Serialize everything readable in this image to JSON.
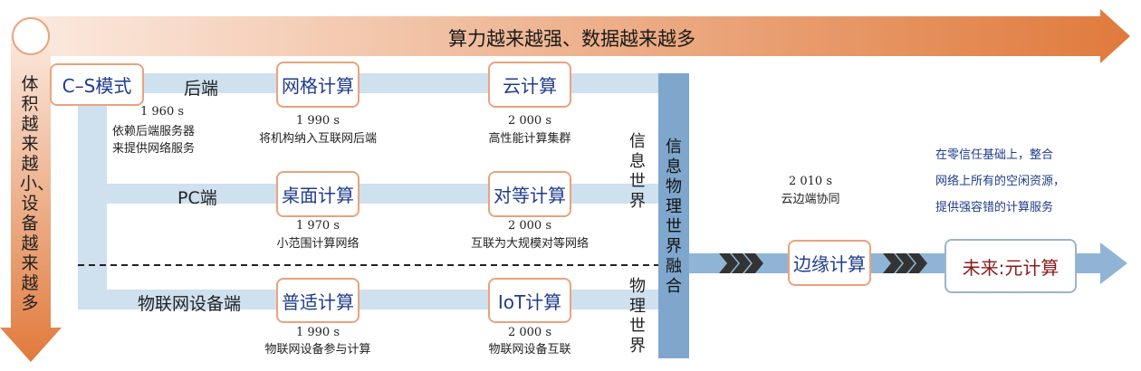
{
  "header": {
    "top_banner": "算力越来越强、数据越来越多"
  },
  "left_banner": "体积越来越小、设备越来越多",
  "rows": {
    "backend": "后端",
    "pc": "PC端",
    "iot": "物联网设备端"
  },
  "nodes": {
    "cs": {
      "label": "C–S模式",
      "year": "1 960 s",
      "desc": [
        "依赖后端服务器",
        "来提供网络服务"
      ]
    },
    "grid": {
      "label": "网格计算",
      "year": "1 990 s",
      "desc": "将机构纳入互联网后端"
    },
    "cloud": {
      "label": "云计算",
      "year": "2 000 s",
      "desc": "高性能计算集群"
    },
    "desktop": {
      "label": "桌面计算",
      "year": "1 970 s",
      "desc": "小范围计算网络"
    },
    "p2p": {
      "label": "对等计算",
      "year": "2 000 s",
      "desc": "互联为大规模对等网络"
    },
    "pervasive": {
      "label": "普适计算",
      "year": "1 990 s",
      "desc": "物联网设备参与计算"
    },
    "iot": {
      "label": "IoT计算",
      "year": "2 000 s",
      "desc": "物联网设备互联"
    },
    "edge": {
      "label": "边缘计算",
      "year": "2 010 s",
      "desc": "云边端协同"
    },
    "meta": {
      "label": "未来:元计算",
      "desc": [
        "在零信任基础上，整合",
        "网络上所有的空闲资源，",
        "提供强容错的计算服务"
      ]
    }
  },
  "labels": {
    "info_world": "信息世界",
    "physical_world": "物理世界",
    "cps_fusion": "信息物理世界融合"
  },
  "colors": {
    "accent_orange": "#e07a3c",
    "bar_blue": "#cfe0ef",
    "fusion_blue": "#7fa6cc",
    "meta_text": "#8b1a1a",
    "desc_blue": "#1f3c8a"
  }
}
